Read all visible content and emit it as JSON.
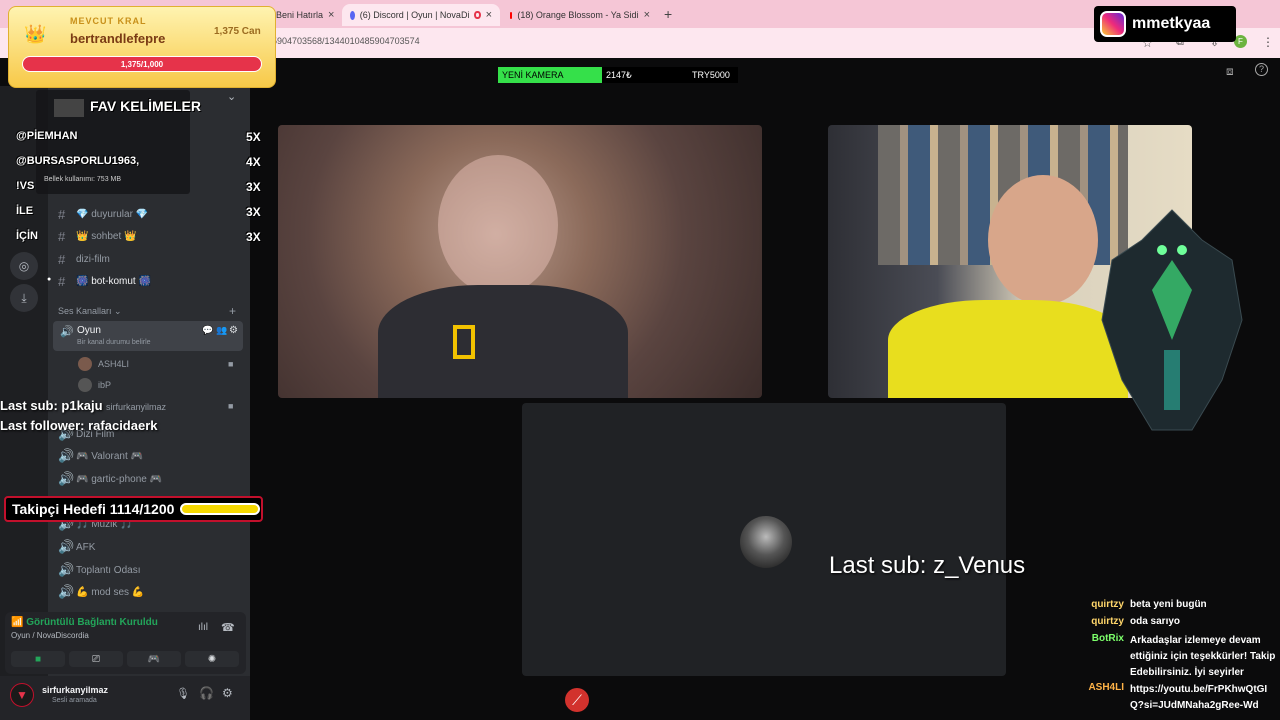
{
  "browser": {
    "tabs": [
      {
        "label": "Beni Hatırla",
        "close": "×"
      },
      {
        "label": "(6) Discord | Oyun | NovaDi",
        "close": "×"
      },
      {
        "label": "(18) Orange Blossom - Ya Sidi",
        "close": "×"
      }
    ],
    "new_tab": "+",
    "url": "5904703568/1344010485904703574",
    "profile_initial": "F"
  },
  "overlays": {
    "kral": {
      "label": "MEVCUT KRAL",
      "name": "bertrandlefepre",
      "can": "1,375 Can",
      "progress_text": "1,375/1,000",
      "progress": 1.0
    },
    "instagram": "mmetkyaa",
    "camera_bar": {
      "label": "YENİ KAMERA",
      "amount": "2147₺",
      "target": "TRY5000",
      "progress": 0.43
    },
    "fav": {
      "title": "FAV KELİMELER",
      "items": [
        {
          "word": "@PİEMHAN",
          "count": "5X"
        },
        {
          "word": "@BURSASPORLU1963,",
          "count": "4X"
        },
        {
          "word": "!VS",
          "count": "3X"
        },
        {
          "word": "İLE",
          "count": "3X"
        },
        {
          "word": "İÇİN",
          "count": "3X"
        }
      ]
    },
    "memory": "Bellek kullanımı: 753 MB",
    "last_sub_left": "Last sub: p1kaju",
    "last_follower": "Last follower: rafacidaerk",
    "takipci": {
      "label": "Takipçi Hedefi 1114/1200",
      "progress": 0.93
    },
    "last_sub_center": "Last sub: z_Venus"
  },
  "sidebar": {
    "text_channels": [
      {
        "name": "💎 duyurular 💎"
      },
      {
        "name": "👑 sohbet 👑"
      },
      {
        "name": "dizi-film"
      },
      {
        "name": "🎆 bot-komut 🎆"
      }
    ],
    "voice_header": "Ses Kanalları",
    "voice_channel": {
      "name": "Oyun",
      "status": "Bir kanal durumu belirle"
    },
    "members": [
      "ASH4LI",
      "ibP",
      "sirfurkanyilmaz"
    ],
    "voice_channels": [
      "Dizi Film",
      "🎮 Valorant 🎮",
      "🎮 gartic-phone 🎮",
      "🎵 Müzik 🎵",
      "AFK",
      "Toplantı Odası",
      "💪 mod ses 💪"
    ]
  },
  "voice_panel": {
    "status": "Görüntülü Bağlantı Kuruldu",
    "location": "Oyun / NovaDiscordia"
  },
  "user_panel": {
    "name": "sirfurkanyilmaz",
    "status": "Sesli aramada"
  },
  "chat": [
    {
      "user": "quirtzy",
      "msg": "beta yeni bugün"
    },
    {
      "user": "quirtzy",
      "msg": "oda sarıyo"
    },
    {
      "user": "BotRix",
      "msg": "Arkadaşlar izlemeye devam ettiğiniz için teşekkürler! Takip Edebilirsiniz. İyi seyirler"
    },
    {
      "user": "ASH4LI",
      "msg": "https://youtu.be/FrPKhwQtGI Q?si=JUdMNaha2gRee-Wd"
    }
  ],
  "colors": {
    "accent": "#e6334a",
    "discord_green": "#23a55a",
    "bg": "#0b0b0c"
  }
}
